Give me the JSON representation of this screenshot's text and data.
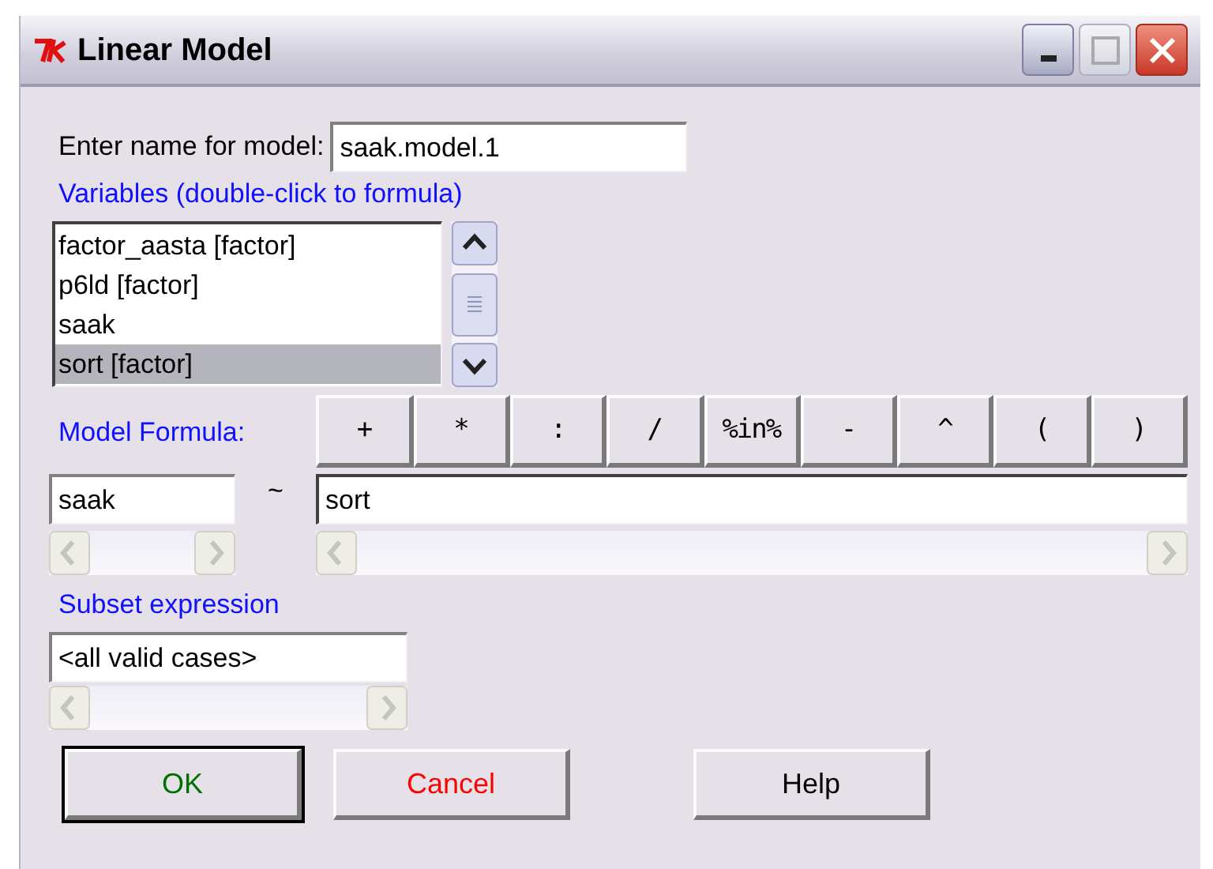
{
  "window": {
    "title": "Linear Model"
  },
  "model_name": {
    "label": "Enter name for model:",
    "value": "saak.model.1"
  },
  "variables": {
    "label": "Variables (double-click to formula)",
    "items": [
      {
        "label": "factor_aasta [factor]",
        "selected": false
      },
      {
        "label": "p6ld [factor]",
        "selected": false
      },
      {
        "label": "saak",
        "selected": false
      },
      {
        "label": "sort [factor]",
        "selected": true
      }
    ]
  },
  "formula": {
    "label": "Model Formula:",
    "operators": [
      "+",
      "*",
      ":",
      "/",
      "%in%",
      "-",
      "^",
      "(",
      ")"
    ],
    "lhs": "saak",
    "tilde": "~",
    "rhs": "sort"
  },
  "subset": {
    "label": "Subset expression",
    "value": "<all valid cases>"
  },
  "buttons": [
    {
      "label": "OK",
      "color": "#007000",
      "default": true
    },
    {
      "label": "Cancel",
      "color": "#ff0000",
      "default": false
    },
    {
      "label": "Help",
      "color": "#000000",
      "default": false
    }
  ]
}
